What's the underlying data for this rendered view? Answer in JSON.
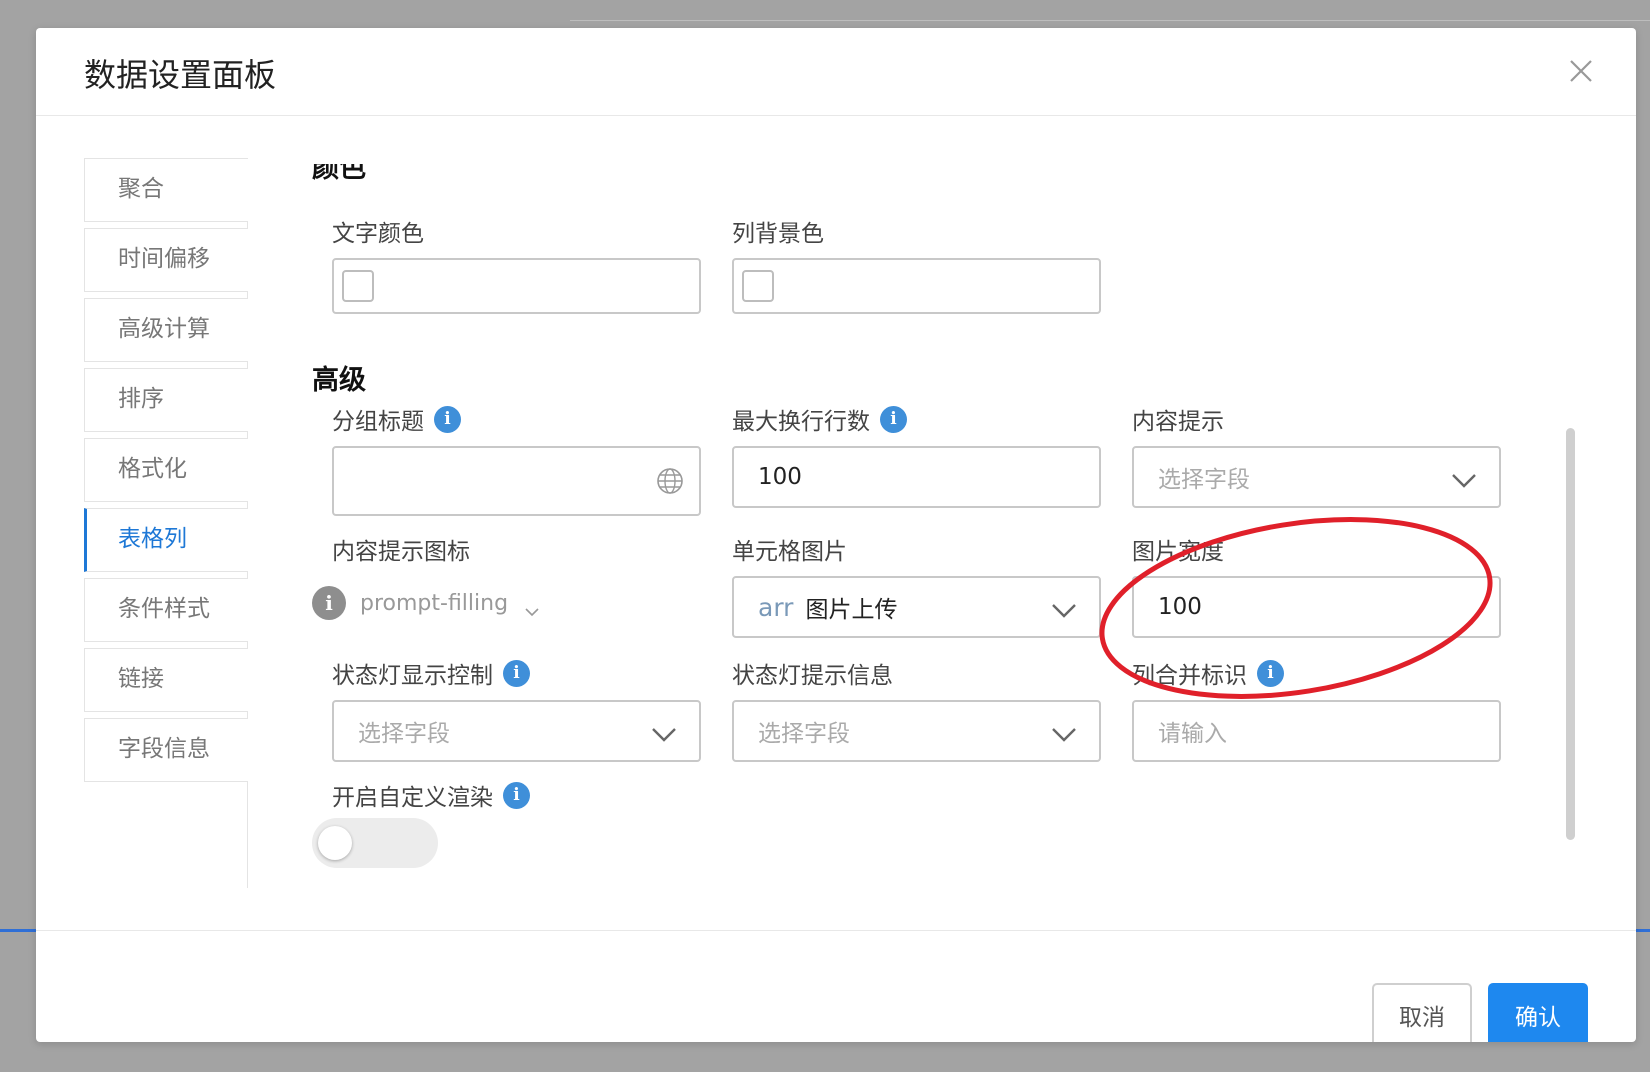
{
  "dialog": {
    "title": "数据设置面板"
  },
  "sidebar": {
    "items": [
      {
        "label": "聚合"
      },
      {
        "label": "时间偏移"
      },
      {
        "label": "高级计算"
      },
      {
        "label": "排序"
      },
      {
        "label": "格式化"
      },
      {
        "label": "表格列",
        "active": true
      },
      {
        "label": "条件样式"
      },
      {
        "label": "链接"
      },
      {
        "label": "字段信息"
      }
    ]
  },
  "color_section": {
    "title": "颜色",
    "text_color_label": "文字颜色",
    "bg_color_label": "列背景色"
  },
  "advanced_section": {
    "title": "高级",
    "group_title_label": "分组标题",
    "max_lines_label": "最大换行行数",
    "max_lines_value": "100",
    "content_tip_label": "内容提示",
    "content_tip_placeholder": "选择字段",
    "content_tip_icon_label": "内容提示图标",
    "content_tip_icon_value": "prompt-filling",
    "cell_image_label": "单元格图片",
    "cell_image_type": "arr",
    "cell_image_value": "图片上传",
    "image_width_label": "图片宽度",
    "image_width_value": "100",
    "status_light_label": "状态灯显示控制",
    "status_light_placeholder": "选择字段",
    "status_tip_label": "状态灯提示信息",
    "status_tip_placeholder": "选择字段",
    "merge_label": "列合并标识",
    "merge_placeholder": "请输入",
    "custom_render_label": "开启自定义渲染"
  },
  "footer": {
    "cancel_label": "取消",
    "ok_label": "确认"
  },
  "colors": {
    "accent": "#1e88ef",
    "annotation": "#e0202a",
    "info_icon": "#3f8fd9"
  }
}
